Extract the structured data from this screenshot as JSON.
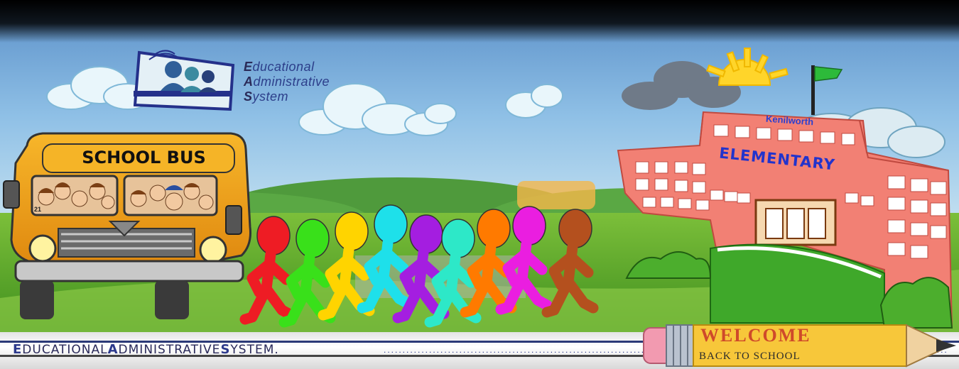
{
  "logo": {
    "line1_first": "E",
    "line1_rest": "ducational",
    "line2_first": "A",
    "line2_rest": "dministrative",
    "line3_first": "S",
    "line3_rest": "ystem"
  },
  "school": {
    "name": "Kenilworth",
    "type": "ELEMENTARY"
  },
  "bus": {
    "label": "SCHOOL BUS",
    "number": "21"
  },
  "footer": {
    "w1_first": "E",
    "w1_rest": "DUCATIONAL",
    "w2_first": "A",
    "w2_rest": "DMINISTRATIVE",
    "w3_first": "S",
    "w3_rest": "YSTEM.",
    "dots": "......................................................................................................................................................................................................................................................................!"
  },
  "pencil": {
    "welcome": "WELCOME",
    "back_to_school": "BACK TO SCHOOL"
  },
  "figures": {
    "colors": [
      "#ee1c24",
      "#39e01a",
      "#ffd400",
      "#1ee0ea",
      "#a41ee0",
      "#2de8c8",
      "#ff7a00",
      "#ea1ee0",
      "#b4501e"
    ]
  }
}
